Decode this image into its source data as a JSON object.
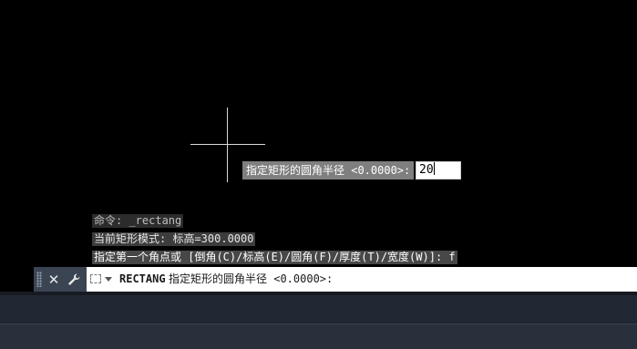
{
  "dynamic_input": {
    "prompt": "指定矩形的圆角半径 <0.0000>:",
    "value": "20"
  },
  "history": [
    "命令: _rectang",
    "当前矩形模式:  标高=300.0000",
    "指定第一个角点或 [倒角(C)/标高(E)/圆角(F)/厚度(T)/宽度(W)]: f"
  ],
  "command_line": {
    "close_glyph": "✕",
    "wrench_glyph": "🔧",
    "command_name": "RECTANG",
    "prompt": "指定矩形的圆角半径 <0.0000>:"
  },
  "icons": {
    "close": "close-icon",
    "customize": "wrench-icon",
    "recent_commands": "recent-commands-icon",
    "crosshair": "crosshair-cursor"
  },
  "colors": {
    "canvas_background": "#000000",
    "crosshair": "#d9d9d9",
    "tooltip_background": "#7f7f7f",
    "command_bar_dark": "#3b4453"
  }
}
